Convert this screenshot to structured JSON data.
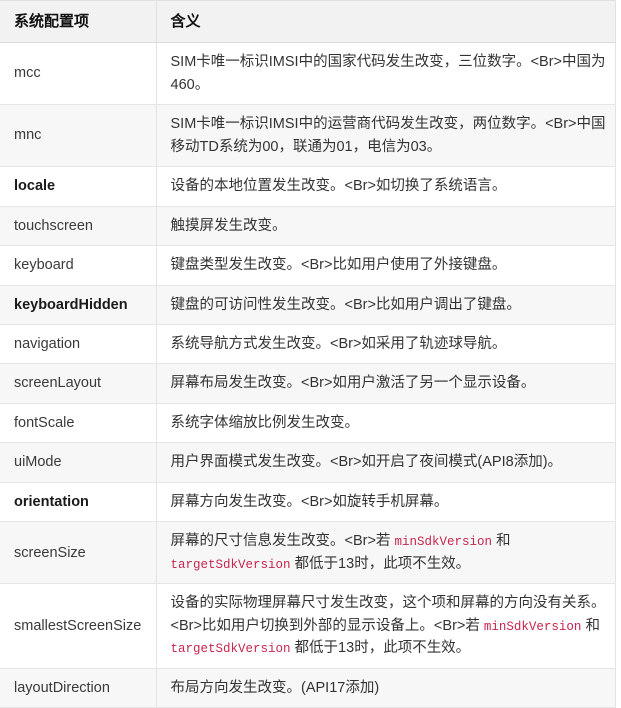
{
  "table": {
    "headers": {
      "key": "系统配置项",
      "meaning": "含义"
    },
    "rows": [
      {
        "key": "mcc",
        "key_bold": false,
        "desc_parts": [
          {
            "type": "text",
            "text": "SIM卡唯一标识IMSI中的国家代码发生改变，三位数字。<Br>中国为460。"
          }
        ]
      },
      {
        "key": "mnc",
        "key_bold": false,
        "desc_parts": [
          {
            "type": "text",
            "text": "SIM卡唯一标识IMSI中的运营商代码发生改变，两位数字。<Br>中国移动TD系统为00，联通为01，电信为03。"
          }
        ]
      },
      {
        "key": "locale",
        "key_bold": true,
        "desc_parts": [
          {
            "type": "text",
            "text": "设备的本地位置发生改变。<Br>如切换了系统语言。"
          }
        ]
      },
      {
        "key": "touchscreen",
        "key_bold": false,
        "desc_parts": [
          {
            "type": "text",
            "text": "触摸屏发生改变。"
          }
        ]
      },
      {
        "key": "keyboard",
        "key_bold": false,
        "desc_parts": [
          {
            "type": "text",
            "text": "键盘类型发生改变。<Br>比如用户使用了外接键盘。"
          }
        ]
      },
      {
        "key": "keyboardHidden",
        "key_bold": true,
        "desc_parts": [
          {
            "type": "text",
            "text": "键盘的可访问性发生改变。<Br>比如用户调出了键盘。"
          }
        ]
      },
      {
        "key": "navigation",
        "key_bold": false,
        "desc_parts": [
          {
            "type": "text",
            "text": "系统导航方式发生改变。<Br>如采用了轨迹球导航。"
          }
        ]
      },
      {
        "key": "screenLayout",
        "key_bold": false,
        "desc_parts": [
          {
            "type": "text",
            "text": "屏幕布局发生改变。<Br>如用户激活了另一个显示设备。"
          }
        ]
      },
      {
        "key": "fontScale",
        "key_bold": false,
        "desc_parts": [
          {
            "type": "text",
            "text": "系统字体缩放比例发生改变。"
          }
        ]
      },
      {
        "key": "uiMode",
        "key_bold": false,
        "desc_parts": [
          {
            "type": "text",
            "text": "用户界面模式发生改变。<Br>如开启了夜间模式(API8添加)。"
          }
        ]
      },
      {
        "key": "orientation",
        "key_bold": true,
        "desc_parts": [
          {
            "type": "text",
            "text": "屏幕方向发生改变。<Br>如旋转手机屏幕。"
          }
        ]
      },
      {
        "key": "screenSize",
        "key_bold": false,
        "desc_parts": [
          {
            "type": "text",
            "text": "屏幕的尺寸信息发生改变。<Br>若 "
          },
          {
            "type": "code",
            "text": "minSdkVersion"
          },
          {
            "type": "text",
            "text": " 和 "
          },
          {
            "type": "code",
            "text": "targetSdkVersion"
          },
          {
            "type": "text",
            "text": " 都低于13时，此项不生效。"
          }
        ]
      },
      {
        "key": "smallestScreenSize",
        "key_bold": false,
        "desc_parts": [
          {
            "type": "text",
            "text": "设备的实际物理屏幕尺寸发生改变，这个项和屏幕的方向没有关系。<Br>比如用户切换到外部的显示设备上。<Br>若 "
          },
          {
            "type": "code",
            "text": "minSdkVersion"
          },
          {
            "type": "text",
            "text": " 和 "
          },
          {
            "type": "code",
            "text": "targetSdkVersion"
          },
          {
            "type": "text",
            "text": " 都低于13时，此项不生效。"
          }
        ]
      },
      {
        "key": "layoutDirection",
        "key_bold": false,
        "desc_parts": [
          {
            "type": "text",
            "text": "布局方向发生改变。(API17添加)"
          }
        ]
      }
    ]
  },
  "colors": {
    "header_bg": "#f2f2f2",
    "stripe_bg": "#f7f7f7",
    "border": "#e3e3e3",
    "code_text": "#c7254e",
    "body_text": "#333333"
  }
}
